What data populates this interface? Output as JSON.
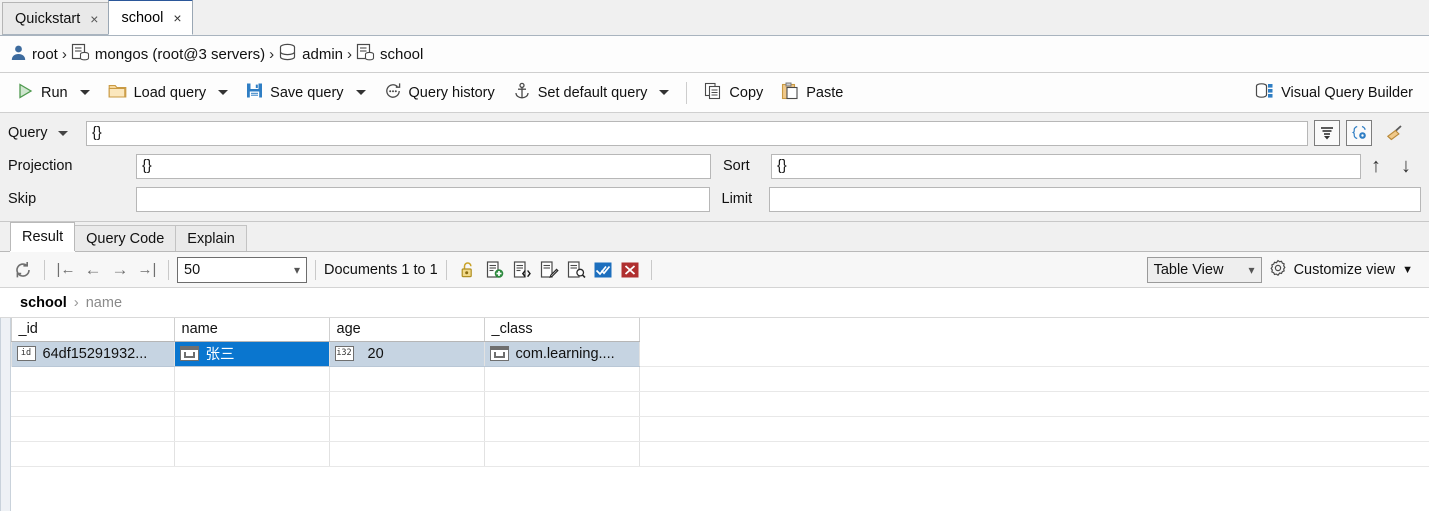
{
  "tabs": [
    {
      "label": "Quickstart",
      "close": "×",
      "active": false
    },
    {
      "label": "school",
      "close": "×",
      "active": true
    }
  ],
  "breadcrumb": {
    "items": [
      {
        "icon": "user-icon",
        "label": "root"
      },
      {
        "icon": "server-icon",
        "label": "mongos (root@3 servers)"
      },
      {
        "icon": "database-icon",
        "label": "admin"
      },
      {
        "icon": "collection-icon",
        "label": "school"
      }
    ],
    "separator": "›"
  },
  "toolbar": {
    "run_label": "Run",
    "load_query_label": "Load query",
    "save_query_label": "Save query",
    "query_history_label": "Query history",
    "set_default_query_label": "Set default query",
    "copy_label": "Copy",
    "paste_label": "Paste",
    "visual_query_builder_label": "Visual Query Builder"
  },
  "query_panel": {
    "query_label": "Query",
    "query_value": "{}",
    "projection_label": "Projection",
    "projection_value": "{}",
    "skip_label": "Skip",
    "skip_value": "",
    "sort_label": "Sort",
    "sort_value": "{}",
    "limit_label": "Limit",
    "limit_value": "",
    "icons": {
      "history_list": "query-list-icon",
      "json_settings": "json-settings-icon",
      "clear_broom": "broom-clear-icon",
      "move_up": "↑",
      "move_down": "↓"
    }
  },
  "result_tabs": [
    {
      "label": "Result",
      "active": true
    },
    {
      "label": "Query Code",
      "active": false
    },
    {
      "label": "Explain",
      "active": false
    }
  ],
  "result_toolbar": {
    "refresh_icon": "refresh-icon",
    "nav_first": "|←",
    "nav_prev": "←",
    "nav_next": "→",
    "nav_last": "→|",
    "page_size": "50",
    "page_size_caret": "⌵",
    "documents_range": "Documents 1 to 1",
    "actions": [
      {
        "name": "unlock-icon",
        "label": "Unlock document"
      },
      {
        "name": "insert-document-icon",
        "label": "Insert document"
      },
      {
        "name": "insert-json-icon",
        "label": "Insert JSON"
      },
      {
        "name": "edit-document-icon",
        "label": "Edit document"
      },
      {
        "name": "view-document-icon",
        "label": "View document"
      },
      {
        "name": "confirm-icon",
        "label": "Confirm"
      },
      {
        "name": "cancel-icon",
        "label": "Cancel"
      }
    ],
    "view_mode": "Table View",
    "view_mode_caret": "⌵",
    "customize_view_label": "Customize view",
    "customize_view_caret": "▼"
  },
  "doc_path": {
    "collection": "school",
    "separator": "›",
    "field": "name"
  },
  "table": {
    "columns": [
      "_id",
      "name",
      "age",
      "_class"
    ],
    "rows": [
      {
        "selected_col": 1,
        "cells": [
          {
            "type_badge": "id",
            "badge_kind": "text",
            "value": "64df15291932..."
          },
          {
            "type_badge": "string",
            "badge_kind": "str",
            "value": "张三"
          },
          {
            "type_badge": "i32",
            "badge_kind": "text",
            "value": "20"
          },
          {
            "type_badge": "string",
            "badge_kind": "str",
            "value": "com.learning...."
          }
        ]
      }
    ],
    "empty_row_count": 4
  },
  "colors": {
    "selection_blue": "#0a76cf",
    "row_highlight": "#c6d4e2",
    "active_tab_accent": "#2b579a",
    "run_green": "#4f9a4f",
    "panel_gray": "#f0f0f0"
  }
}
